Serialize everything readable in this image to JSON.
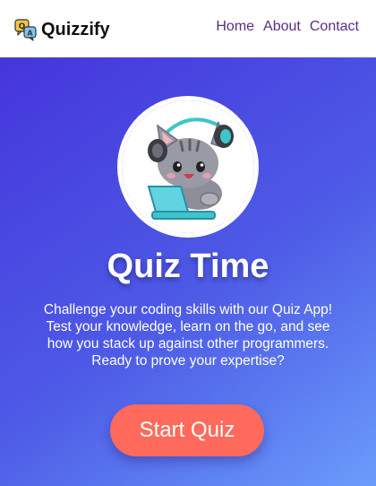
{
  "navbar": {
    "brand_name": "Quizzify",
    "brand_logo_icon": "quiz-chat-bubbles-icon",
    "links": [
      {
        "label": "Home"
      },
      {
        "label": "About"
      },
      {
        "label": "Contact"
      }
    ]
  },
  "hero": {
    "avatar_icon": "cat-with-headphones-laptop-icon",
    "title": "Quiz Time",
    "description": "Challenge your coding skills with our Quiz App! Test your knowledge, learn on the go, and see how you stack up against other programmers. Ready to prove your expertise?",
    "start_button_label": "Start Quiz"
  },
  "colors": {
    "nav_link": "#5b2c83",
    "gradient_start": "#4535dc",
    "gradient_end": "#6a9cfb",
    "button": "#ff6a5c"
  }
}
